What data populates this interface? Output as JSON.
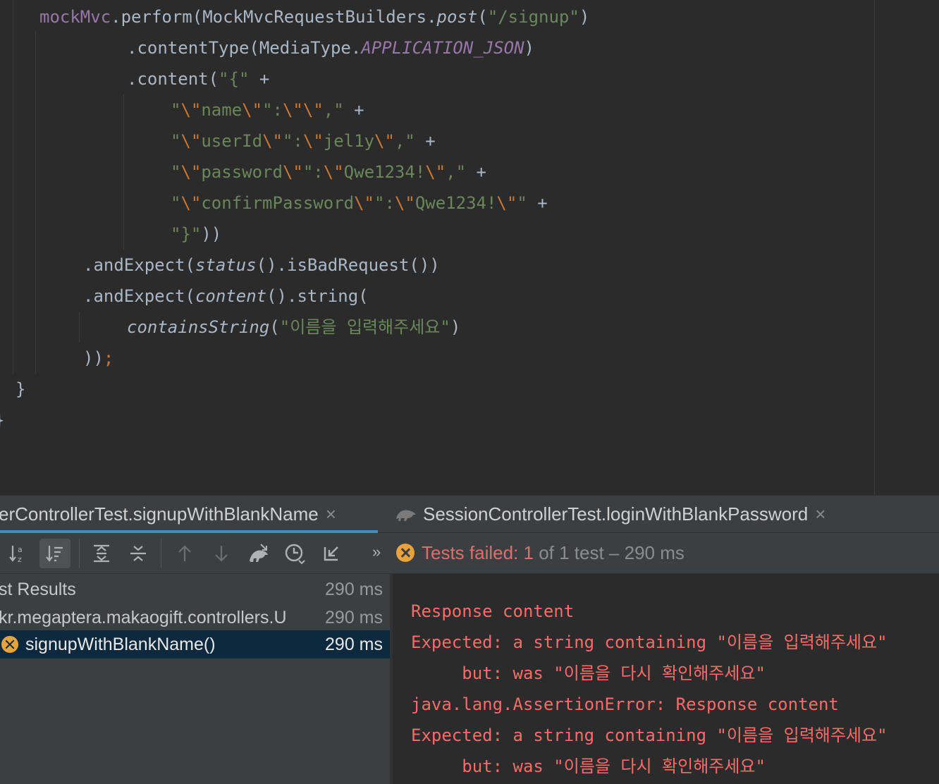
{
  "editor": {
    "lines": [
      {
        "id": "l1",
        "parts": [
          {
            "t": "mockMvc",
            "c": "t-field"
          },
          {
            "t": ".perform(MockMvcRequestBuilders.",
            "c": "t-plain"
          },
          {
            "t": "post",
            "c": "t-plain t-ital"
          },
          {
            "t": "(",
            "c": "t-plain"
          },
          {
            "t": "\"/signup\"",
            "c": "t-str"
          },
          {
            "t": ")",
            "c": "t-plain"
          }
        ]
      },
      {
        "id": "l2",
        "parts": [
          {
            "t": ".contentType(MediaType.",
            "c": "t-plain"
          },
          {
            "t": "APPLICATION_JSON",
            "c": "t-const"
          },
          {
            "t": ")",
            "c": "t-plain"
          }
        ]
      },
      {
        "id": "l3",
        "parts": [
          {
            "t": ".content(",
            "c": "t-plain"
          },
          {
            "t": "\"{\"",
            "c": "t-str"
          },
          {
            "t": " +",
            "c": "t-plain"
          }
        ]
      },
      {
        "id": "l4",
        "parts": [
          {
            "t": "\"",
            "c": "t-str"
          },
          {
            "t": "\\\"",
            "c": "t-esc"
          },
          {
            "t": "name",
            "c": "t-str"
          },
          {
            "t": "\\\"",
            "c": "t-esc"
          },
          {
            "t": "\":",
            "c": "t-str"
          },
          {
            "t": "\\\"\\\"",
            "c": "t-esc"
          },
          {
            "t": ",\"",
            "c": "t-str"
          },
          {
            "t": " +",
            "c": "t-plain"
          }
        ]
      },
      {
        "id": "l5",
        "parts": [
          {
            "t": "\"",
            "c": "t-str"
          },
          {
            "t": "\\\"",
            "c": "t-esc"
          },
          {
            "t": "userId",
            "c": "t-str"
          },
          {
            "t": "\\\"",
            "c": "t-esc"
          },
          {
            "t": "\":",
            "c": "t-str"
          },
          {
            "t": "\\\"",
            "c": "t-esc"
          },
          {
            "t": "jel1y",
            "c": "t-str"
          },
          {
            "t": "\\\"",
            "c": "t-esc"
          },
          {
            "t": ",\"",
            "c": "t-str"
          },
          {
            "t": " +",
            "c": "t-plain"
          }
        ]
      },
      {
        "id": "l6",
        "parts": [
          {
            "t": "\"",
            "c": "t-str"
          },
          {
            "t": "\\\"",
            "c": "t-esc"
          },
          {
            "t": "password",
            "c": "t-str"
          },
          {
            "t": "\\\"",
            "c": "t-esc"
          },
          {
            "t": "\":",
            "c": "t-str"
          },
          {
            "t": "\\\"",
            "c": "t-esc"
          },
          {
            "t": "Qwe1234!",
            "c": "t-str"
          },
          {
            "t": "\\\"",
            "c": "t-esc"
          },
          {
            "t": ",\"",
            "c": "t-str"
          },
          {
            "t": " +",
            "c": "t-plain"
          }
        ]
      },
      {
        "id": "l7",
        "parts": [
          {
            "t": "\"",
            "c": "t-str"
          },
          {
            "t": "\\\"",
            "c": "t-esc"
          },
          {
            "t": "confirmPassword",
            "c": "t-str"
          },
          {
            "t": "\\\"",
            "c": "t-esc"
          },
          {
            "t": "\":",
            "c": "t-str"
          },
          {
            "t": "\\\"",
            "c": "t-esc"
          },
          {
            "t": "Qwe1234!",
            "c": "t-str"
          },
          {
            "t": "\\\"",
            "c": "t-esc"
          },
          {
            "t": "\"",
            "c": "t-str"
          },
          {
            "t": " +",
            "c": "t-plain"
          }
        ]
      },
      {
        "id": "l8",
        "parts": [
          {
            "t": "\"}\"",
            "c": "t-str"
          },
          {
            "t": "))",
            "c": "t-plain"
          }
        ]
      },
      {
        "id": "l9",
        "parts": [
          {
            "t": ".andExpect(",
            "c": "t-plain"
          },
          {
            "t": "status",
            "c": "t-plain t-ital"
          },
          {
            "t": "().isBadRequest())",
            "c": "t-plain"
          }
        ]
      },
      {
        "id": "l10",
        "parts": [
          {
            "t": ".andExpect(",
            "c": "t-plain"
          },
          {
            "t": "content",
            "c": "t-plain t-ital"
          },
          {
            "t": "().string(",
            "c": "t-plain"
          }
        ]
      },
      {
        "id": "l11",
        "parts": [
          {
            "t": "containsString",
            "c": "t-plain t-ital"
          },
          {
            "t": "(",
            "c": "t-plain"
          },
          {
            "t": "\"이름을 입력해주세요\"",
            "c": "t-str"
          },
          {
            "t": ")",
            "c": "t-plain"
          }
        ]
      },
      {
        "id": "l12",
        "parts": [
          {
            "t": "))",
            "c": "t-plain"
          },
          {
            "t": ";",
            "c": "t-semi"
          }
        ]
      },
      {
        "id": "l13",
        "parts": [
          {
            "t": "}",
            "c": "t-plain"
          }
        ]
      },
      {
        "id": "l14",
        "parts": [
          {
            "t": "}",
            "c": "t-plain"
          }
        ]
      }
    ]
  },
  "tabs": [
    {
      "label": "erControllerTest.signupWithBlankName",
      "close": "×",
      "active": true
    },
    {
      "label": "SessionControllerTest.loginWithBlankPassword",
      "close": "×",
      "active": false
    }
  ],
  "toolbar": {
    "icons": [
      "sort-alphabetically-icon",
      "sort-by-duration-icon",
      "expand-all-icon",
      "collapse-all-icon",
      "previous-failed-icon",
      "next-failed-icon",
      "import-tests-icon",
      "test-history-icon",
      "export-results-icon"
    ],
    "more": "»",
    "status_failed": "Tests failed: 1",
    "status_rest": " of 1 test – 290 ms"
  },
  "tree": {
    "rows": [
      {
        "name": "st Results",
        "duration": "290 ms"
      },
      {
        "name": "kr.megaptera.makaogift.controllers.U",
        "duration": "290 ms"
      },
      {
        "name": "signupWithBlankName()",
        "duration": "290 ms",
        "failed": true
      }
    ]
  },
  "console": {
    "lines": [
      "Response content",
      "Expected: a string containing \"이름을 입력해주세요\"",
      "     but: was \"이름을 다시 확인해주세요\"",
      "java.lang.AssertionError: Response content",
      "Expected: a string containing \"이름을 입력해주세요\"",
      "     but: was \"이름을 다시 확인해주세요\""
    ]
  },
  "colors": {
    "background": "#2b2b2b",
    "panel": "#3c3f41",
    "keyword_field": "#9876aa",
    "string": "#6a8759",
    "escape": "#cc7832",
    "error_text": "#ff6b68",
    "failed_icon": "#e8a33d",
    "selection": "#0d293e",
    "tab_underline": "#4a88c7"
  }
}
